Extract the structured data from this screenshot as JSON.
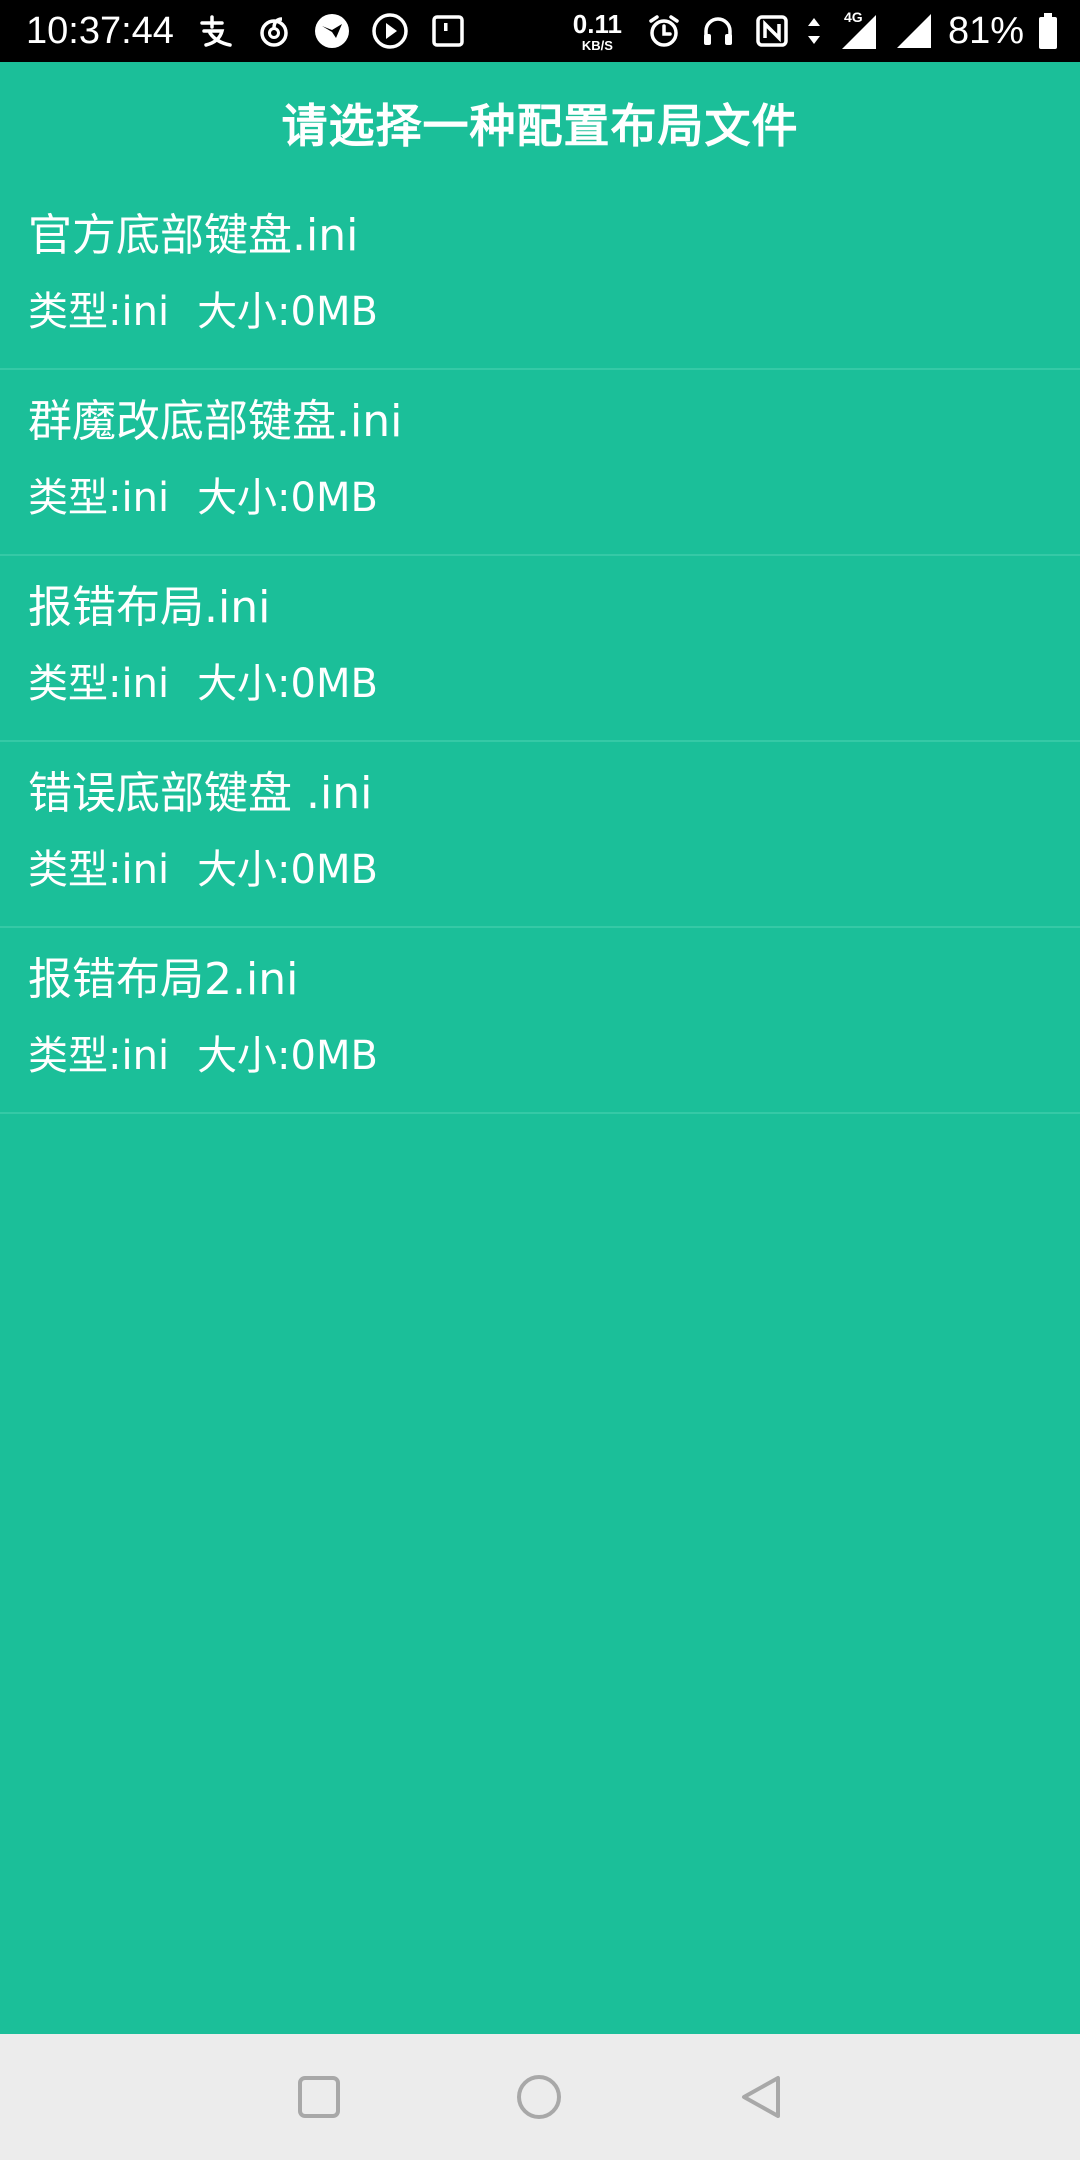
{
  "status_bar": {
    "time": "10:37:44",
    "net_speed_value": "0.11",
    "net_speed_unit": "KB/S",
    "network_type": "4G",
    "battery_percent": "81%",
    "left_icons": [
      "alipay-icon",
      "netease-music-icon",
      "bird-app-icon",
      "play-circle-icon",
      "square-notification-icon"
    ],
    "right_icons": [
      "alarm-icon",
      "headset-icon",
      "nfc-icon",
      "data-arrows-icon",
      "signal-4g-icon",
      "signal-icon",
      "battery-icon"
    ]
  },
  "header": {
    "title": "请选择一种配置布局文件"
  },
  "files": [
    {
      "name": "官方底部键盘.ini",
      "type": "类型:ini",
      "size": "大小:0MB"
    },
    {
      "name": "群魔改底部键盘.ini",
      "type": "类型:ini",
      "size": "大小:0MB"
    },
    {
      "name": "报错布局.ini",
      "type": "类型:ini",
      "size": "大小:0MB"
    },
    {
      "name": "错误底部键盘 .ini",
      "type": "类型:ini",
      "size": "大小:0MB"
    },
    {
      "name": "报错布局2.ini",
      "type": "类型:ini",
      "size": "大小:0MB"
    }
  ],
  "nav_bar": {
    "buttons": [
      "recents-square-icon",
      "home-circle-icon",
      "back-triangle-icon"
    ]
  },
  "colors": {
    "background": "#1bbf99",
    "divider": "#35c9a6",
    "status_bar": "#000000",
    "nav_bar": "#ececec",
    "nav_icon": "#a8a8a8",
    "text": "#ffffff"
  }
}
